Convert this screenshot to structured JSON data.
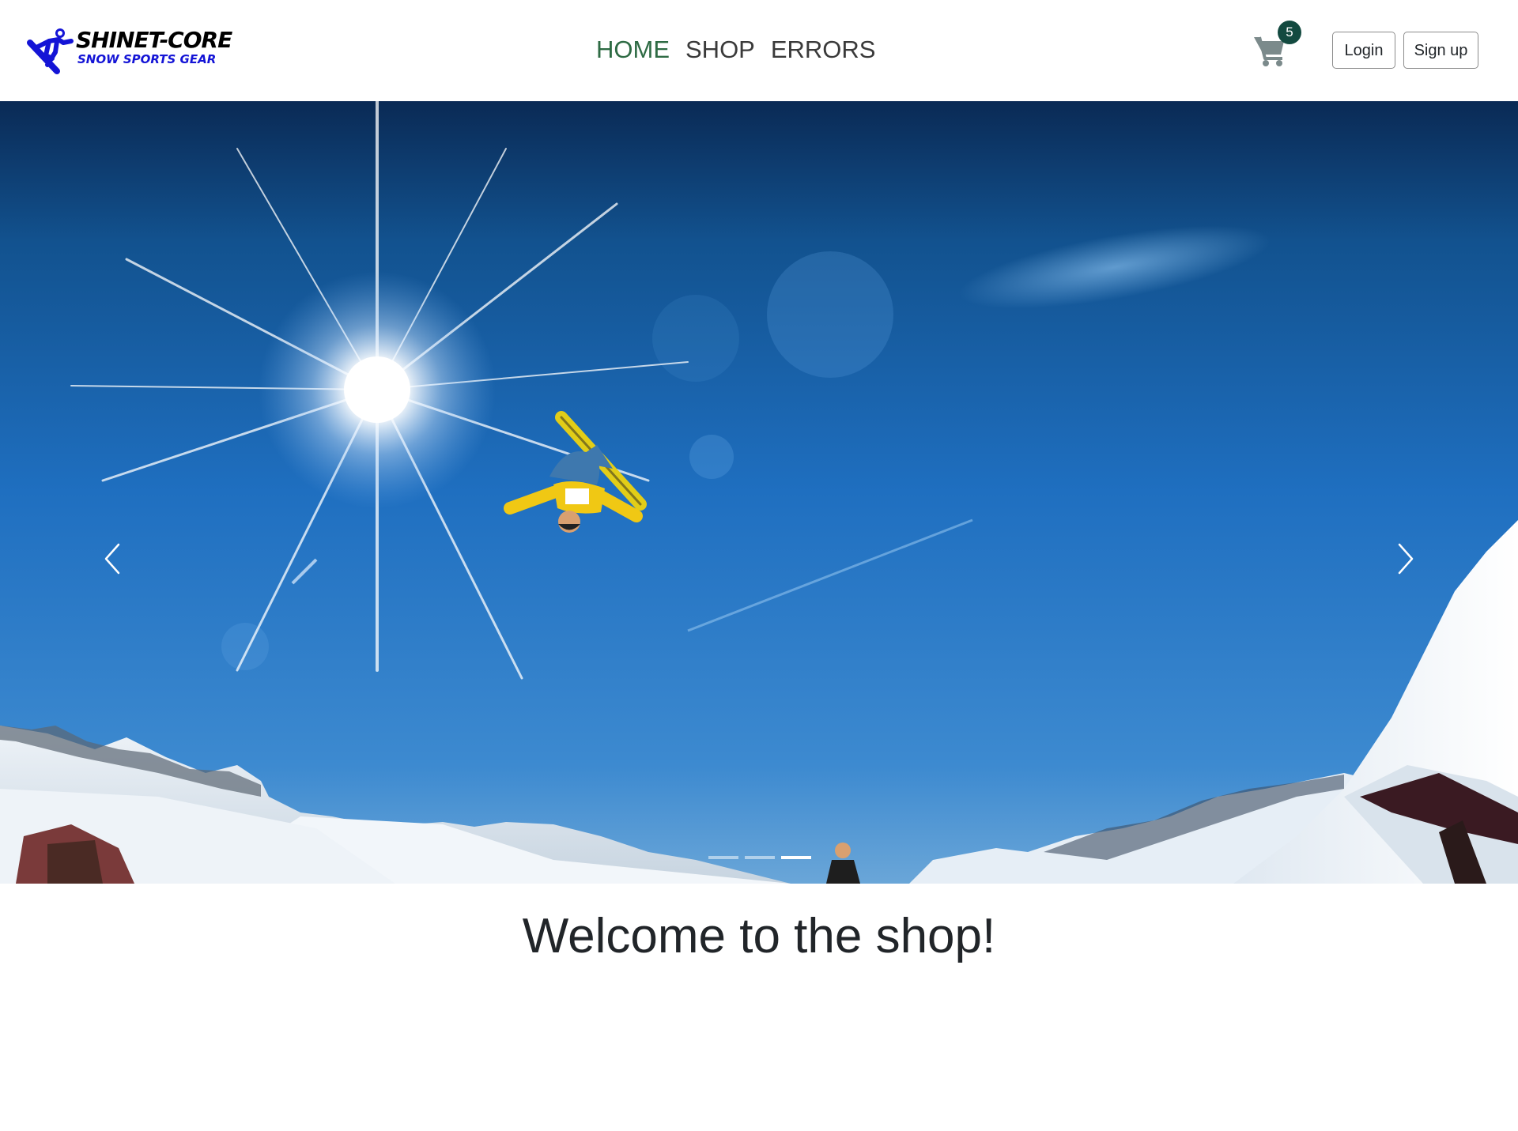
{
  "brand": {
    "name_top": "SHINET-CORE",
    "name_bottom": "SNOW SPORTS GEAR",
    "logo_icon": "snowboarder-icon",
    "logo_color": "#1414d6"
  },
  "nav": {
    "links": [
      {
        "label": "HOME",
        "active": true
      },
      {
        "label": "SHOP",
        "active": false
      },
      {
        "label": "ERRORS",
        "active": false
      }
    ],
    "active_color": "#2e6b44"
  },
  "cart": {
    "icon": "shopping-cart-icon",
    "count": "5",
    "badge_color": "#134a40"
  },
  "auth": {
    "login_label": "Login",
    "signup_label": "Sign up"
  },
  "carousel": {
    "slide_count": 3,
    "active_slide": 3,
    "prev_icon": "chevron-left-icon",
    "next_icon": "chevron-right-icon"
  },
  "main": {
    "heading": "Welcome to the shop!"
  }
}
